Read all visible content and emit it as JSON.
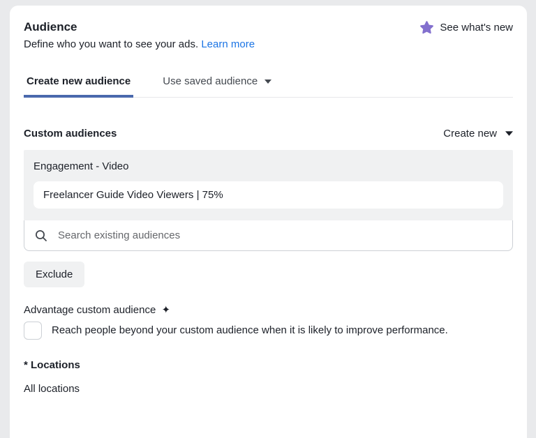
{
  "colors": {
    "tab_indicator_blue": "#4a69ad",
    "link_blue": "#1b74e4",
    "star_purple": "#8370ce",
    "box_gray": "#f0f1f2"
  },
  "icons": {
    "star": "star-icon",
    "sparkle_glyph": "✦",
    "search": "magnifier-icon",
    "caret": "caret-down-icon"
  },
  "header": {
    "title": "Audience",
    "subtitle": "Define who you want to see your ads.",
    "learn_more_label": "Learn more",
    "whats_new_label": "See what's new"
  },
  "tabs": [
    {
      "label": "Create new audience",
      "active": true
    },
    {
      "label": "Use saved audience",
      "active": false
    }
  ],
  "custom_audiences": {
    "section_label": "Custom audiences",
    "create_new_label": "Create new",
    "group_label": "Engagement - Video",
    "selected_audience": "Freelancer Guide Video Viewers | 75%",
    "search_placeholder": "Search existing audiences",
    "search_value": "",
    "exclude_label": "Exclude"
  },
  "advantage": {
    "title": "Advantage custom audience",
    "checkbox_checked": false,
    "checkbox_label": "Reach people beyond your custom audience when it is likely to improve performance."
  },
  "locations": {
    "label": "* Locations",
    "value": "All locations"
  }
}
